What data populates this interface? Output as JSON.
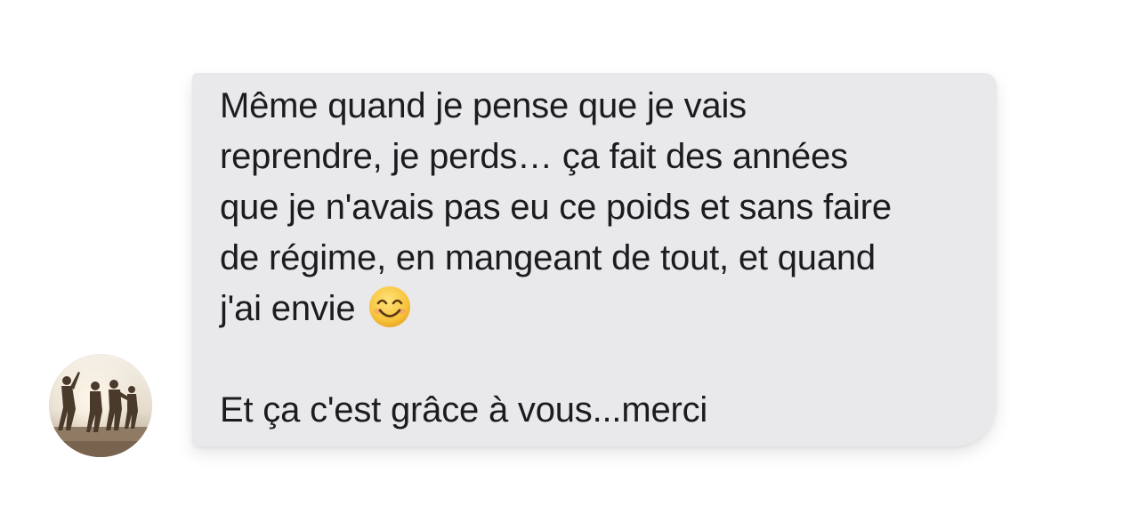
{
  "message": {
    "lines": [
      "Même quand je pense que je vais",
      "reprendre, je perds… ça fait des années",
      "que je n'avais pas eu ce poids et sans faire",
      "de régime, en mangeant de tout, et quand",
      "j'ai envie"
    ],
    "closing": "Et ça c'est grâce à vous...merci",
    "emoji": "smiling-face-icon"
  },
  "avatar": {
    "icon": "avatar-photo-people-dancing"
  },
  "colors": {
    "bubble": "#e9e9eb",
    "text": "#1c1c1e",
    "emoji": "#f7c33a"
  }
}
